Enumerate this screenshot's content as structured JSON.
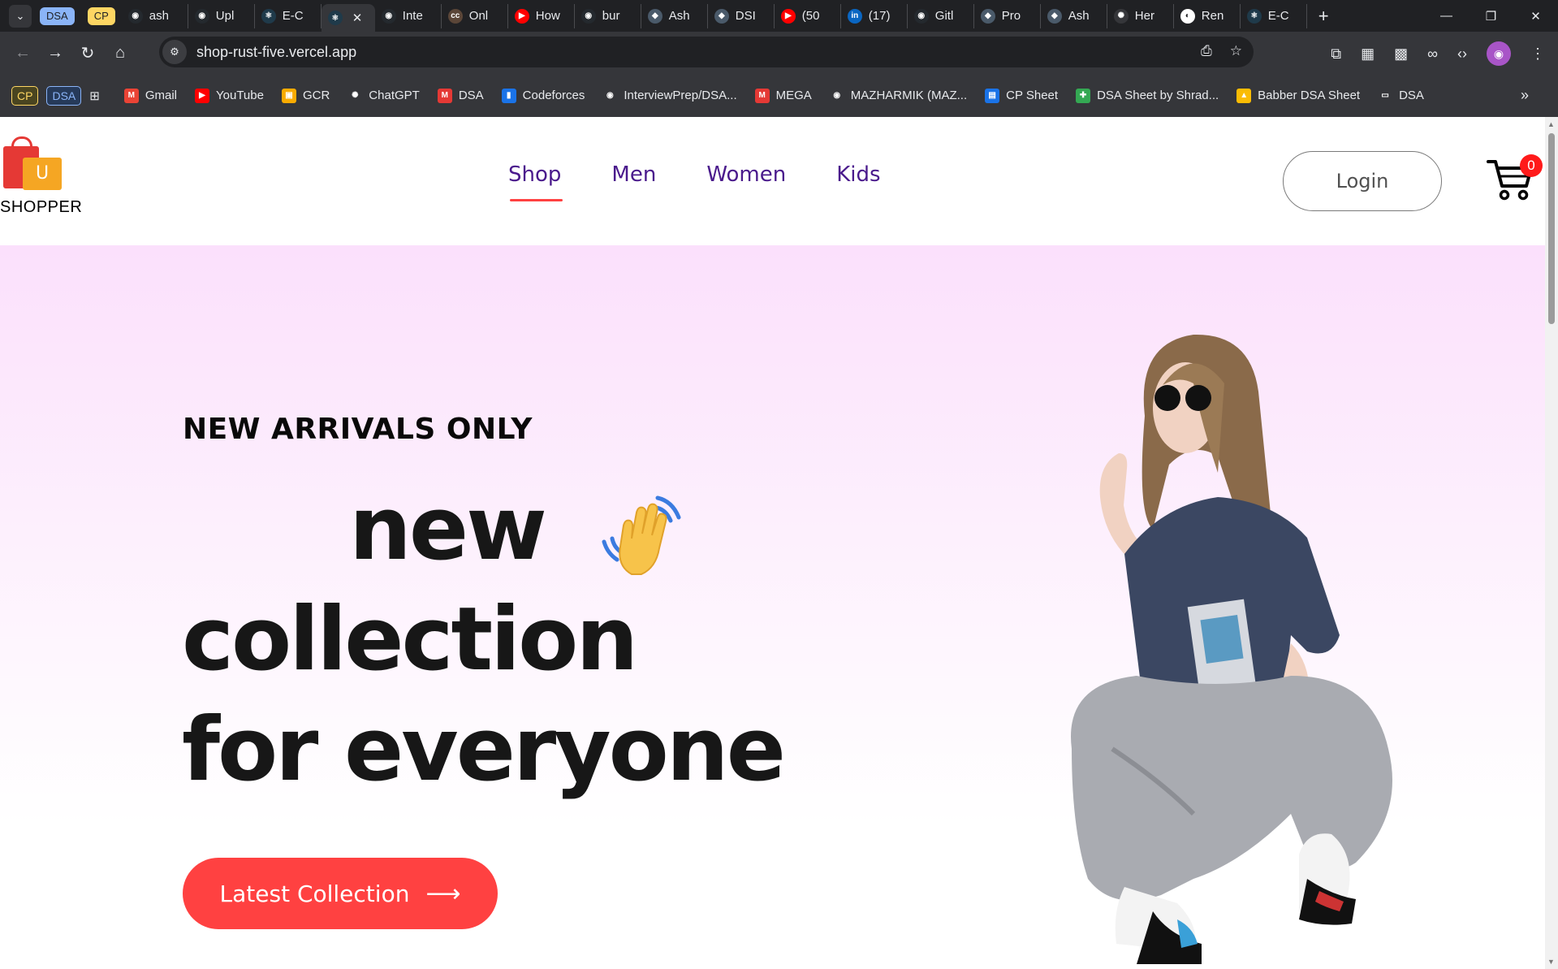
{
  "browser": {
    "tab_groups": [
      "DSA",
      "CP"
    ],
    "tabs": [
      {
        "label": "ash",
        "icon": "github-icon"
      },
      {
        "label": "Upl",
        "icon": "github-icon"
      },
      {
        "label": "E-C",
        "icon": "react-icon"
      },
      {
        "label": "",
        "icon": "react-icon",
        "active": true
      },
      {
        "label": "Inte",
        "icon": "github-icon"
      },
      {
        "label": "Onl",
        "icon": "codechef-icon"
      },
      {
        "label": "How",
        "icon": "youtube-icon"
      },
      {
        "label": "bur",
        "icon": "github-icon"
      },
      {
        "label": "Ash",
        "icon": "site-icon"
      },
      {
        "label": "DSI",
        "icon": "site-icon"
      },
      {
        "label": "(50",
        "icon": "youtube-icon"
      },
      {
        "label": "(17)",
        "icon": "linkedin-icon"
      },
      {
        "label": "Gitl",
        "icon": "github-icon"
      },
      {
        "label": "Pro",
        "icon": "site-icon"
      },
      {
        "label": "Ash",
        "icon": "site-icon"
      },
      {
        "label": "Her",
        "icon": "chatgpt-icon"
      },
      {
        "label": "Ren",
        "icon": "render-icon"
      },
      {
        "label": "E-C",
        "icon": "react-icon"
      }
    ],
    "url": "shop-rust-five.vercel.app",
    "bookmark_tags": [
      "CP",
      "DSA"
    ],
    "bookmarks": [
      {
        "label": "Gmail",
        "color": "#ea4335",
        "glyph": "M"
      },
      {
        "label": "YouTube",
        "color": "#ff0000",
        "glyph": "▶"
      },
      {
        "label": "GCR",
        "color": "#f9ab00",
        "glyph": "▣"
      },
      {
        "label": "ChatGPT",
        "color": "#35363a",
        "glyph": "✺"
      },
      {
        "label": "DSA",
        "color": "#e53935",
        "glyph": "M"
      },
      {
        "label": "Codeforces",
        "color": "#1a73e8",
        "glyph": "▮"
      },
      {
        "label": "InterviewPrep/DSA...",
        "color": "#35363a",
        "glyph": "◉"
      },
      {
        "label": "MEGA",
        "color": "#e53935",
        "glyph": "M"
      },
      {
        "label": "MAZHARMIK (MAZ...",
        "color": "#35363a",
        "glyph": "◉"
      },
      {
        "label": "CP Sheet",
        "color": "#1a73e8",
        "glyph": "▤"
      },
      {
        "label": "DSA Sheet by Shrad...",
        "color": "#34a853",
        "glyph": "✚"
      },
      {
        "label": "Babber DSA Sheet",
        "color": "#fbbc04",
        "glyph": "▲"
      },
      {
        "label": "DSA",
        "color": "#35363a",
        "glyph": "▭"
      }
    ]
  },
  "site": {
    "logo_text": "SHOPPER",
    "logo_bag_letter": "U",
    "nav": [
      "Shop",
      "Men",
      "Women",
      "Kids"
    ],
    "login_label": "Login",
    "cart_count": "0",
    "hero": {
      "tag": "NEW ARRIVALS ONLY",
      "line1": "new",
      "line2": "collection",
      "line3": "for everyone",
      "cta_label": "Latest Collection",
      "cta_arrow": "⟶"
    }
  },
  "colors": {
    "accent": "#ff4141",
    "nav_text": "#4a1a8c",
    "hero_gradient_top": "#fbe0fc"
  }
}
